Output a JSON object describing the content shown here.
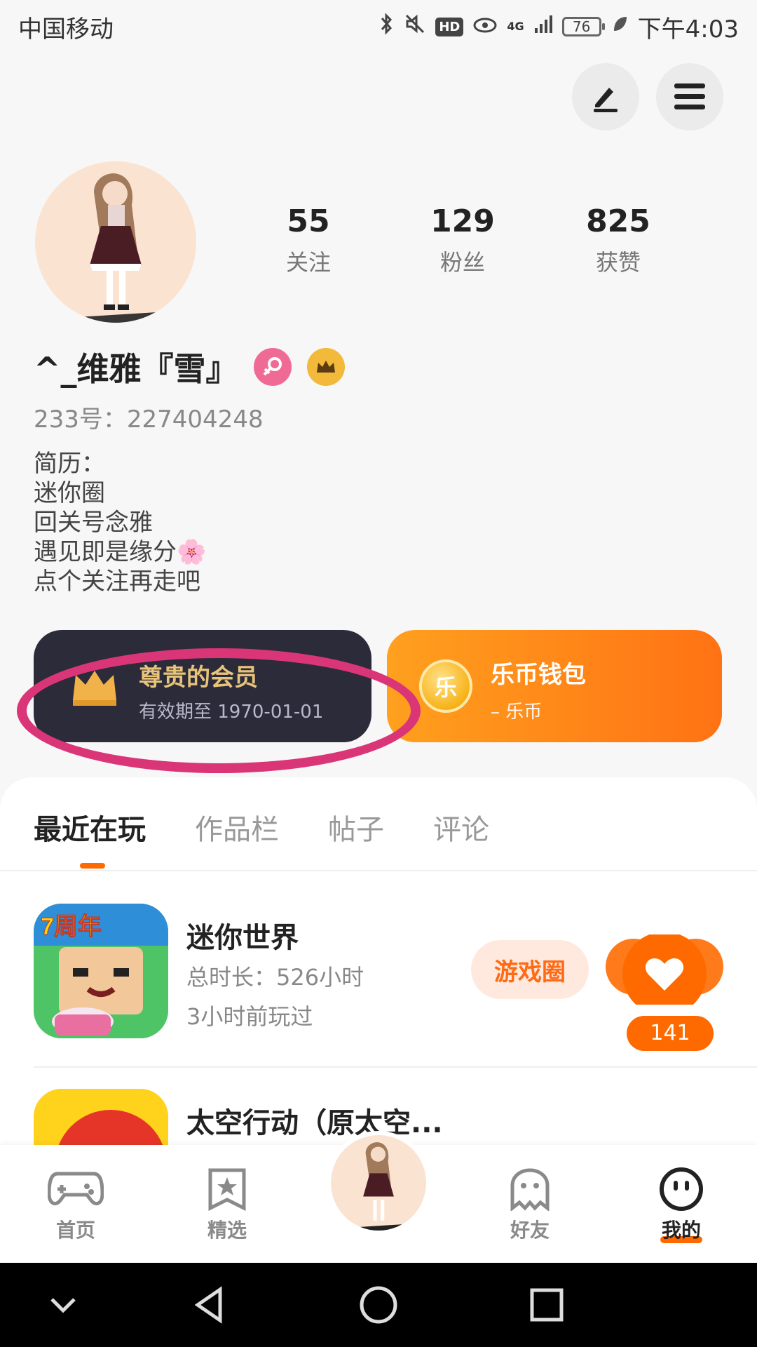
{
  "status_bar": {
    "carrier": "中国移动",
    "hd": "HD",
    "network": "4G",
    "battery": "76",
    "time": "下午4:03"
  },
  "profile": {
    "stats": [
      {
        "num": "55",
        "label": "关注"
      },
      {
        "num": "129",
        "label": "粉丝"
      },
      {
        "num": "825",
        "label": "获赞"
      }
    ],
    "username": "^_维雅『雪』",
    "user_id": "233号：227404248",
    "bio": [
      "简历：",
      "迷你圈",
      "回关号念雅",
      "遇见即是缘分",
      "点个关注再走吧"
    ],
    "bio_emoji": "🌸"
  },
  "member_card": {
    "title": "尊贵的会员",
    "validity": "有效期至 1970-01-01"
  },
  "wallet_card": {
    "coin_char": "乐",
    "title": "乐币钱包",
    "balance": "– 乐币"
  },
  "tabs": [
    "最近在玩",
    "作品栏",
    "帖子",
    "评论"
  ],
  "games": [
    {
      "name": "迷你世界",
      "playtime": "总时长：526小时",
      "last_played": "3小时前玩过",
      "circle_label": "游戏圈",
      "likes": "141",
      "icon_text": "7周年"
    },
    {
      "name": "太空行动（原太空..."
    }
  ],
  "bottom_nav": {
    "items": [
      {
        "label": "首页",
        "icon": "gamepad-icon"
      },
      {
        "label": "精选",
        "icon": "star-bookmark-icon"
      },
      {
        "label": "好友",
        "icon": "ghost-icon"
      },
      {
        "label": "我的",
        "icon": "face-icon"
      }
    ]
  },
  "colors": {
    "accent": "#ff6a00",
    "annotation": "#d93577",
    "member_bg": "#2b2b3a"
  }
}
